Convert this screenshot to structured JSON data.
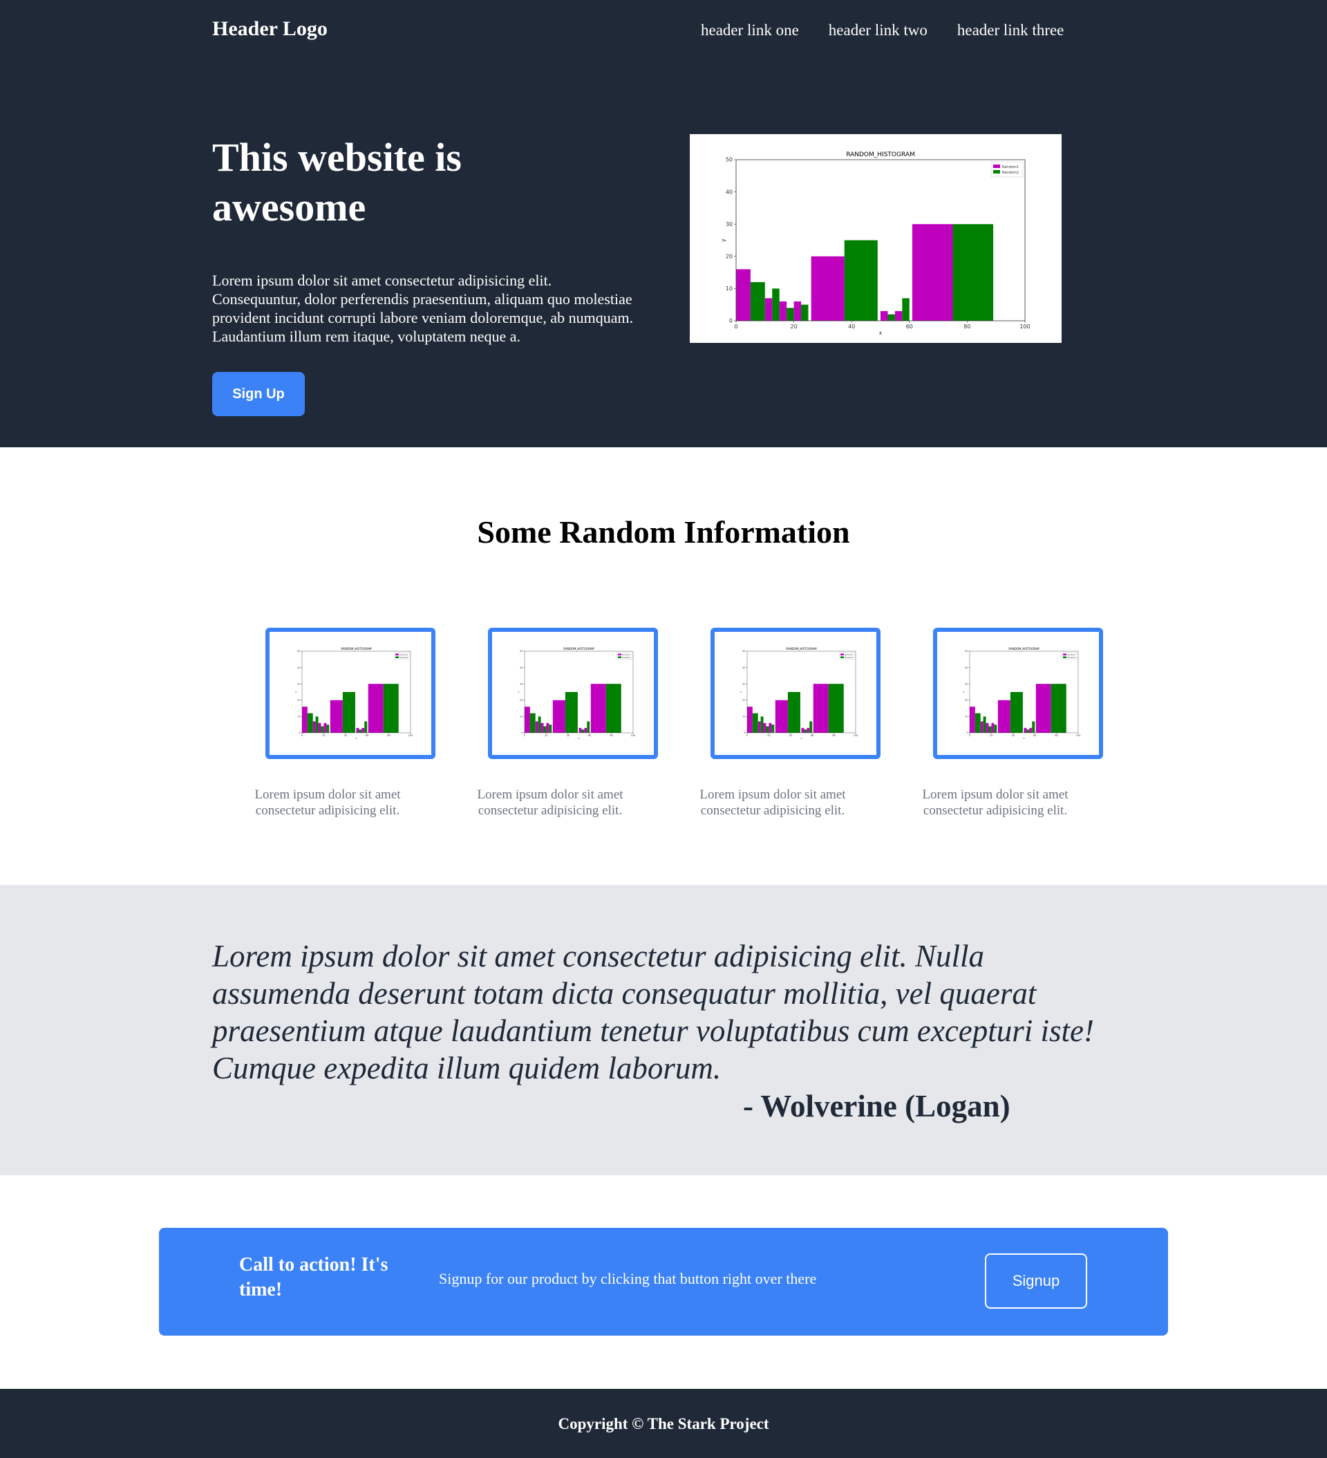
{
  "header": {
    "logo": "Header Logo",
    "links": [
      "header link one",
      "header link two",
      "header link three"
    ]
  },
  "hero": {
    "title": "This website is awesome",
    "text": "Lorem ipsum dolor sit amet consectetur adipisicing elit. Consequuntur, dolor perferendis praesentium, aliquam quo molestiae provident incidunt corrupti labore veniam doloremque, ab numquam. Laudantium illum rem itaque, voluptatem neque a.",
    "button_label": "Sign Up"
  },
  "info": {
    "title": "Some Random Information",
    "cards": [
      {
        "text": "Lorem ipsum dolor sit amet consectetur adipisicing elit."
      },
      {
        "text": "Lorem ipsum dolor sit amet consectetur adipisicing elit."
      },
      {
        "text": "Lorem ipsum dolor sit amet consectetur adipisicing elit."
      },
      {
        "text": "Lorem ipsum dolor sit amet consectetur adipisicing elit."
      }
    ]
  },
  "quote": {
    "text": "Lorem ipsum dolor sit amet consectetur adipisicing elit. Nulla assumenda deserunt totam dicta consequatur mollitia, vel quaerat praesentium atque laudantium tenetur voluptatibus cum excepturi iste! Cumque expedita illum quidem laborum.",
    "author": "- Wolverine (Logan)"
  },
  "cta": {
    "title": "Call to action! It's time!",
    "text": "Signup for our product by clicking that button right over there",
    "button_label": "Signup"
  },
  "footer": {
    "text": "Copyright © The Stark Project"
  },
  "colors": {
    "dark": "#1f2937",
    "accent": "#3b82f6",
    "quote_bg": "#e5e7eb",
    "series_a": "#bf00bf",
    "series_b": "#008000"
  },
  "chart_data": {
    "type": "bar",
    "title": "RANDOM_HISTOGRAM",
    "xlabel": "x",
    "ylabel": "y",
    "xlim": [
      0,
      100
    ],
    "ylim": [
      0,
      50
    ],
    "xticks": [
      0,
      20,
      40,
      60,
      80,
      100
    ],
    "yticks": [
      0,
      10,
      20,
      30,
      40,
      50
    ],
    "legend": "top-right",
    "series": [
      {
        "name": "Random1",
        "color": "#bf00bf",
        "bars": [
          {
            "x0": 0,
            "x1": 5,
            "value": 16
          },
          {
            "x0": 10,
            "x1": 12.5,
            "value": 7
          },
          {
            "x0": 15,
            "x1": 17.5,
            "value": 6
          },
          {
            "x0": 20,
            "x1": 22.5,
            "value": 6
          },
          {
            "x0": 26,
            "x1": 37.5,
            "value": 20
          },
          {
            "x0": 50,
            "x1": 52.5,
            "value": 3
          },
          {
            "x0": 55,
            "x1": 57.5,
            "value": 3
          },
          {
            "x0": 61,
            "x1": 75,
            "value": 30
          }
        ]
      },
      {
        "name": "Random2",
        "color": "#008000",
        "bars": [
          {
            "x0": 5,
            "x1": 10,
            "value": 12
          },
          {
            "x0": 12.5,
            "x1": 15,
            "value": 10
          },
          {
            "x0": 17.5,
            "x1": 20,
            "value": 4
          },
          {
            "x0": 22.5,
            "x1": 25,
            "value": 5
          },
          {
            "x0": 37.5,
            "x1": 49,
            "value": 25
          },
          {
            "x0": 52.5,
            "x1": 55,
            "value": 2
          },
          {
            "x0": 57.5,
            "x1": 60,
            "value": 7
          },
          {
            "x0": 75,
            "x1": 89,
            "value": 30
          }
        ]
      }
    ]
  }
}
